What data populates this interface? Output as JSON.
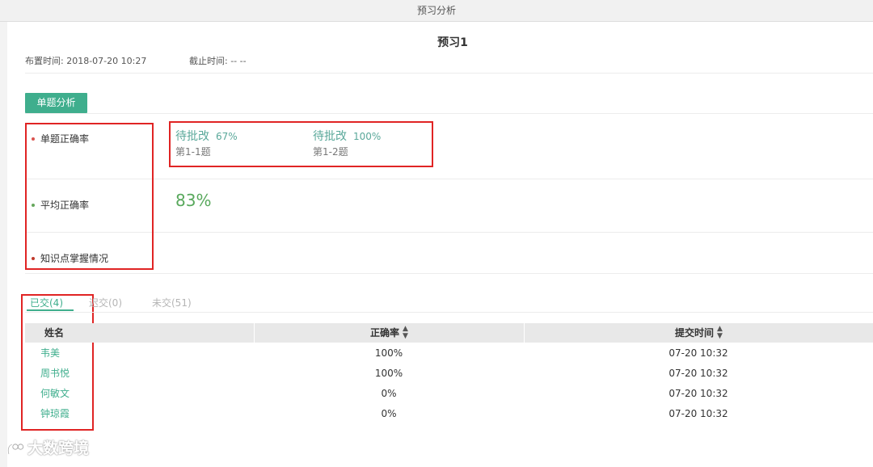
{
  "window": {
    "title": "预习分析"
  },
  "header": {
    "title": "预习1",
    "publish_time": "布置时间: 2018-07-20 10:27",
    "deadline": "截止时间: -- --"
  },
  "section": {
    "button_label": "单题分析"
  },
  "metrics": {
    "single_accuracy_label": "单题正确率",
    "avg_accuracy_label": "平均正确率",
    "knowledge_label": "知识点掌握情况",
    "questions": [
      {
        "status": "待批改",
        "percent": "67%",
        "range": "第1-1题"
      },
      {
        "status": "待批改",
        "percent": "100%",
        "range": "第1-2题"
      }
    ],
    "avg_value": "83%"
  },
  "tabs": [
    {
      "label": "已交(4)",
      "active": true
    },
    {
      "label": "迟交(0)",
      "active": false
    },
    {
      "label": "未交(51)",
      "active": false
    }
  ],
  "table": {
    "columns": [
      "姓名",
      "正确率",
      "提交时间"
    ],
    "rows": [
      {
        "name": "韦美",
        "accuracy": "100%",
        "time": "07-20 10:32"
      },
      {
        "name": "周书悦",
        "accuracy": "100%",
        "time": "07-20 10:32"
      },
      {
        "name": "何敏文",
        "accuracy": "0%",
        "time": "07-20 10:32"
      },
      {
        "name": "钟琼霞",
        "accuracy": "0%",
        "time": "07-20 10:32"
      }
    ]
  },
  "watermark": {
    "text": "大数跨境"
  },
  "colors": {
    "accent": "#3fae8d",
    "highlight_box": "#e02424",
    "avg_green": "#58a85c"
  }
}
